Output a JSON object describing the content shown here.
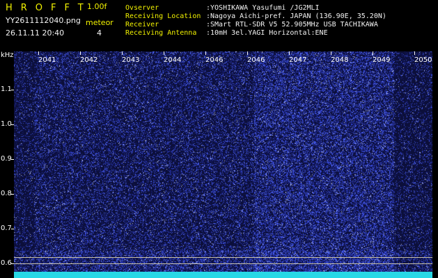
{
  "header": {
    "logo": "HROFFT",
    "version": "1.00f",
    "filename": "YY2611112040.png",
    "datetime": "26.11.11 20:40",
    "meteor_label": "meteor",
    "meteor_count": "4",
    "info": [
      {
        "key": "Ovserver",
        "value": ":YOSHIKAWA Yasufumi /JG2MLI"
      },
      {
        "key": "Receiving Location",
        "value": ":Nagoya Aichi-pref. JAPAN (136.90E, 35.20N)"
      },
      {
        "key": "Receiver",
        "value": ":SMart RTL-SDR V5 52.905MHz USB TACHIKAWA"
      },
      {
        "key": "Receiving Antenna",
        "value": ":10mH 3el.YAGI Horizontal:ENE"
      }
    ]
  },
  "y_axis": {
    "unit": "kHz",
    "ticks": [
      "1.1",
      "1.0",
      "0.9",
      "0.8",
      "0.7",
      "0.6"
    ]
  },
  "x_axis": {
    "ticks": [
      "2041",
      "2042",
      "2043",
      "2044",
      "2046",
      "2046",
      "2047",
      "2048",
      "2049",
      "2050"
    ]
  },
  "colors": {
    "header_label": "#f2f200",
    "header_value": "#f4f4f4",
    "spectrogram_bg": "#0c0f3a",
    "noise": "#4a5cff",
    "trace": "#27d8e6"
  }
}
